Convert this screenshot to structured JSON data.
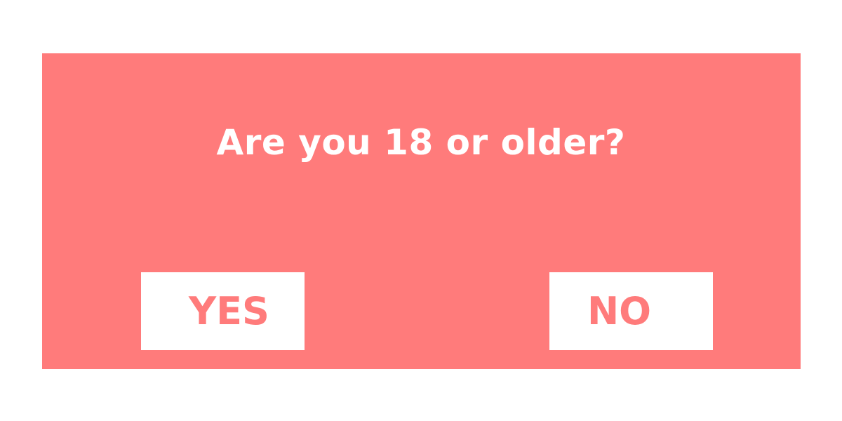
{
  "dialog": {
    "question": "Are you 18 or older?",
    "yes_label": "YES",
    "no_label": "NO"
  },
  "colors": {
    "accent": "#ff7b7b",
    "background": "#ffffff",
    "button_background": "#ffffff",
    "text_on_accent": "#ffffff"
  }
}
